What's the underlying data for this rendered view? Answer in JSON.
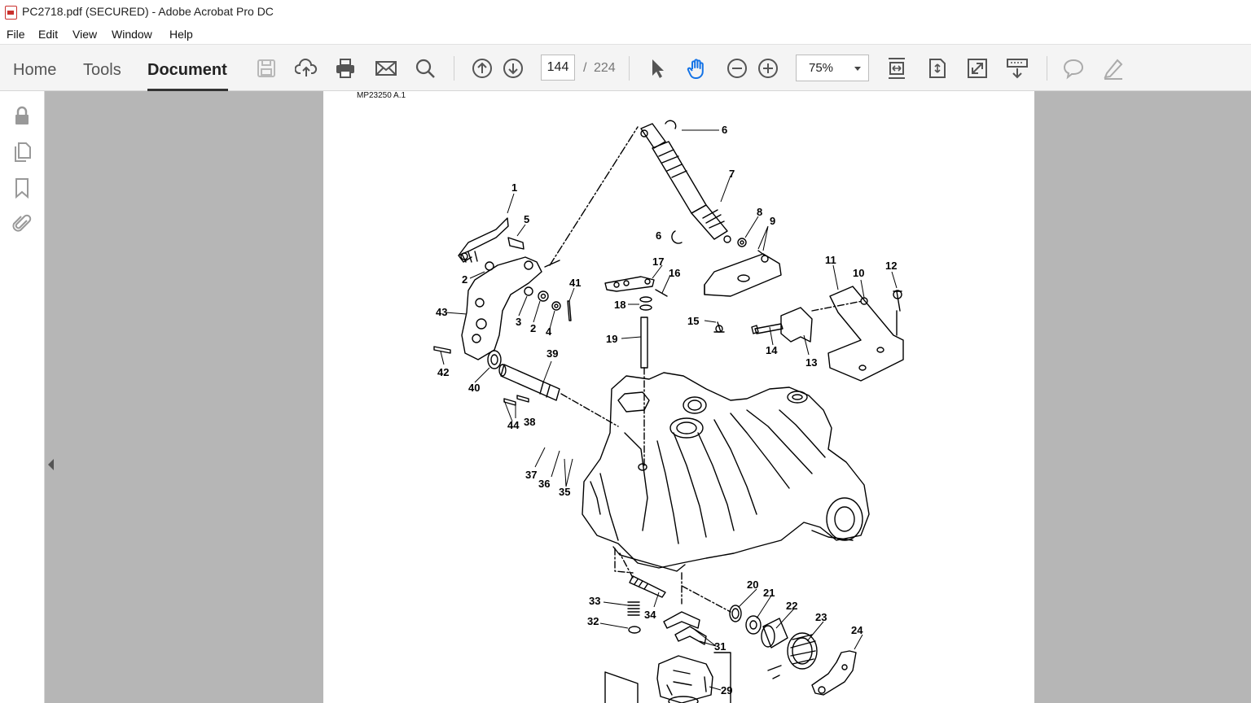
{
  "window": {
    "title": "PC2718.pdf (SECURED) - Adobe Acrobat Pro DC"
  },
  "menu": {
    "file": "File",
    "edit": "Edit",
    "view": "View",
    "window": "Window",
    "help": "Help"
  },
  "tabs": {
    "home": "Home",
    "tools": "Tools",
    "document": "Document"
  },
  "toolbar": {
    "icons": [
      "save-icon",
      "cloud-upload-icon",
      "print-icon",
      "email-icon",
      "search-icon",
      "page-up-icon",
      "page-down-icon",
      "select-arrow-icon",
      "hand-icon",
      "zoom-out-icon",
      "zoom-in-icon",
      "fit-width-icon",
      "fit-page-icon",
      "full-screen-icon",
      "read-mode-icon",
      "comment-icon",
      "highlight-pen-icon"
    ],
    "page_current": "144",
    "page_separator": "/",
    "page_total": "224",
    "zoom": "75%"
  },
  "sidebar": {
    "icons": [
      "lock-icon",
      "pages-icon",
      "bookmark-icon",
      "attachment-icon"
    ]
  },
  "document": {
    "figure_ref": "MP23250 A.1",
    "callouts": [
      "1",
      "2",
      "2",
      "3",
      "4",
      "5",
      "6",
      "6",
      "7",
      "8",
      "9",
      "10",
      "11",
      "12",
      "13",
      "14",
      "15",
      "16",
      "17",
      "18",
      "19",
      "20",
      "21",
      "22",
      "23",
      "24",
      "29",
      "31",
      "32",
      "33",
      "34",
      "35",
      "36",
      "37",
      "38",
      "39",
      "40",
      "41",
      "42",
      "43",
      "44"
    ]
  },
  "colors": {
    "toolbar_bg": "#f4f4f4",
    "viewer_bg": "#b6b6b6",
    "accent_active_tab": "#333333"
  }
}
